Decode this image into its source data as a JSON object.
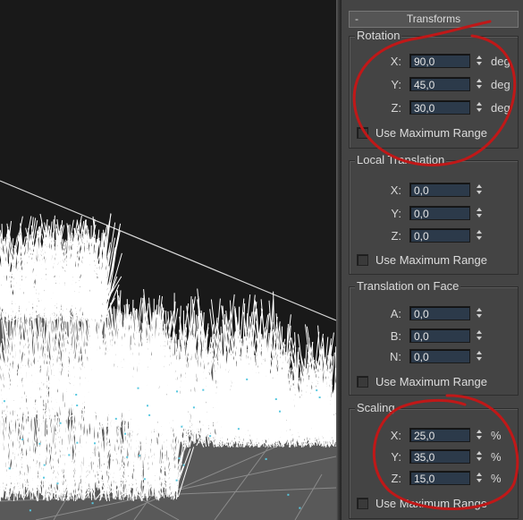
{
  "panel": {
    "rollout": {
      "toggle": "-",
      "title": "Transforms"
    },
    "groups": [
      {
        "title": "Rotation",
        "rows": [
          {
            "axis": "X:",
            "value": "90,0",
            "unit": "deg"
          },
          {
            "axis": "Y:",
            "value": "45,0",
            "unit": "deg"
          },
          {
            "axis": "Z:",
            "value": "30,0",
            "unit": "deg"
          }
        ],
        "checkbox": {
          "label": "Use Maximum Range",
          "checked": false
        }
      },
      {
        "title": "Local Translation",
        "rows": [
          {
            "axis": "X:",
            "value": "0,0",
            "unit": ""
          },
          {
            "axis": "Y:",
            "value": "0,0",
            "unit": ""
          },
          {
            "axis": "Z:",
            "value": "0,0",
            "unit": ""
          }
        ],
        "checkbox": {
          "label": "Use Maximum Range",
          "checked": false
        }
      },
      {
        "title": "Translation on Face",
        "rows": [
          {
            "axis": "A:",
            "value": "0,0",
            "unit": ""
          },
          {
            "axis": "B:",
            "value": "0,0",
            "unit": ""
          },
          {
            "axis": "N:",
            "value": "0,0",
            "unit": ""
          }
        ],
        "checkbox": {
          "label": "Use Maximum Range",
          "checked": false
        }
      },
      {
        "title": "Scaling",
        "rows": [
          {
            "axis": "X:",
            "value": "25,0",
            "unit": "%"
          },
          {
            "axis": "Y:",
            "value": "35,0",
            "unit": "%"
          },
          {
            "axis": "Z:",
            "value": "15,0",
            "unit": "%"
          }
        ],
        "checkbox": {
          "label": "Use Maximum Range",
          "checked": false
        }
      }
    ]
  },
  "colors": {
    "panel_bg": "#444444",
    "field_bg": "#2c3a4a",
    "annotation_red": "#c01818",
    "viewport_bg": "#191919",
    "grass": "#ffffff",
    "floor": "#5a5a5a"
  }
}
